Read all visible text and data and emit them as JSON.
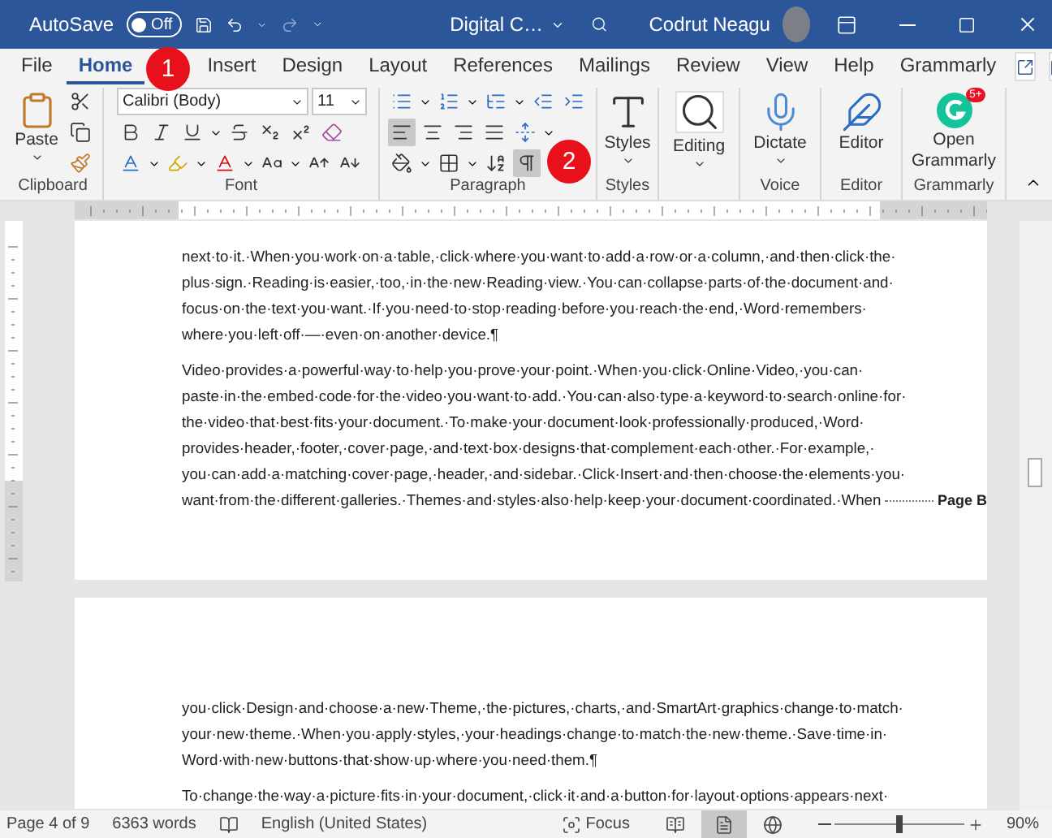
{
  "titlebar": {
    "autosave_label": "AutoSave",
    "autosave": {
      "on": false,
      "label": "Off"
    },
    "document_title": "Digital C…",
    "user_name": "Codrut Neagu"
  },
  "tabs": [
    {
      "label": "File",
      "selected": false
    },
    {
      "label": "Home",
      "selected": true
    },
    {
      "label": "Insert",
      "selected": false
    },
    {
      "label": "Design",
      "selected": false
    },
    {
      "label": "Layout",
      "selected": false
    },
    {
      "label": "References",
      "selected": false
    },
    {
      "label": "Mailings",
      "selected": false
    },
    {
      "label": "Review",
      "selected": false
    },
    {
      "label": "View",
      "selected": false
    },
    {
      "label": "Help",
      "selected": false
    },
    {
      "label": "Grammarly",
      "selected": false
    }
  ],
  "ribbon": {
    "clipboard": {
      "paste_label": "Paste",
      "group_label": "Clipboard"
    },
    "font": {
      "font_name": "Calibri (Body)",
      "font_size": "11",
      "group_label": "Font"
    },
    "paragraph": {
      "align": [
        {
          "selected": true
        },
        {
          "selected": false
        },
        {
          "selected": false
        },
        {
          "selected": false
        }
      ],
      "show_marks": {
        "selected": true
      },
      "group_label": "Paragraph"
    },
    "big_buttons": [
      {
        "kind": "styles",
        "label": "Styles",
        "group_label": "Styles"
      },
      {
        "kind": "editing",
        "label": "Editing"
      },
      {
        "kind": "dictate",
        "label": "Dictate",
        "group_label": "Voice"
      },
      {
        "kind": "editor",
        "label": "Editor",
        "group_label": "Editor"
      },
      {
        "kind": "grammarly",
        "label": "Open Grammarly",
        "badge": "5+",
        "group_label": "Grammarly"
      }
    ]
  },
  "callouts": [
    {
      "label": "1"
    },
    {
      "label": "2"
    }
  ],
  "pages": [
    {
      "paragraphs": [
        {
          "lines": [
            "next·to·it.·When·you·work·on·a·table,·click·where·you·want·to·add·a·row·or·a·column,·and·then·click·the·",
            "plus·sign.·Reading·is·easier,·too,·in·the·new·Reading·view.·You·can·collapse·parts·of·the·document·and·",
            "focus·on·the·text·you·want.·If·you·need·to·stop·reading·before·you·reach·the·end,·Word·remembers·",
            "where·you·left·off·—·even·on·another·device.¶"
          ]
        },
        {
          "lines": [
            "Video·provides·a·powerful·way·to·help·you·prove·your·point.·When·you·click·Online·Video,·you·can·",
            "paste·in·the·embed·code·for·the·video·you·want·to·add.·You·can·also·type·a·keyword·to·search·online·for·",
            "the·video·that·best·fits·your·document.·To·make·your·document·look·professionally·produced,·Word·",
            "provides·header,·footer,·cover·page,·and·text·box·designs·that·complement·each·other.·For·example,·",
            "you·can·add·a·matching·cover·page,·header,·and·sidebar.·Click·Insert·and·then·choose·the·elements·you·",
            "want·from·the·different·galleries.·Themes·and·styles·also·help·keep·your·document·coordinated.·When"
          ],
          "page_break": "Page B"
        }
      ]
    },
    {
      "paragraphs": [
        {
          "lines": [
            "you·click·Design·and·choose·a·new·Theme,·the·pictures,·charts,·and·SmartArt·graphics·change·to·match·",
            "your·new·theme.·When·you·apply·styles,·your·headings·change·to·match·the·new·theme.·Save·time·in·",
            "Word·with·new·buttons·that·show·up·where·you·need·them.¶"
          ]
        },
        {
          "lines": [
            "To·change·the·way·a·picture·fits·in·your·document,·click·it·and·a·button·for·layout·options·appears·next·"
          ]
        }
      ]
    }
  ],
  "status": {
    "page": "Page 4 of 9",
    "words": "6363 words",
    "language": "English (United States)",
    "focus": "Focus",
    "views": [
      {
        "selected": false
      },
      {
        "selected": true
      },
      {
        "selected": false
      }
    ],
    "zoom": {
      "level": 0.5,
      "reading": "90%"
    }
  }
}
